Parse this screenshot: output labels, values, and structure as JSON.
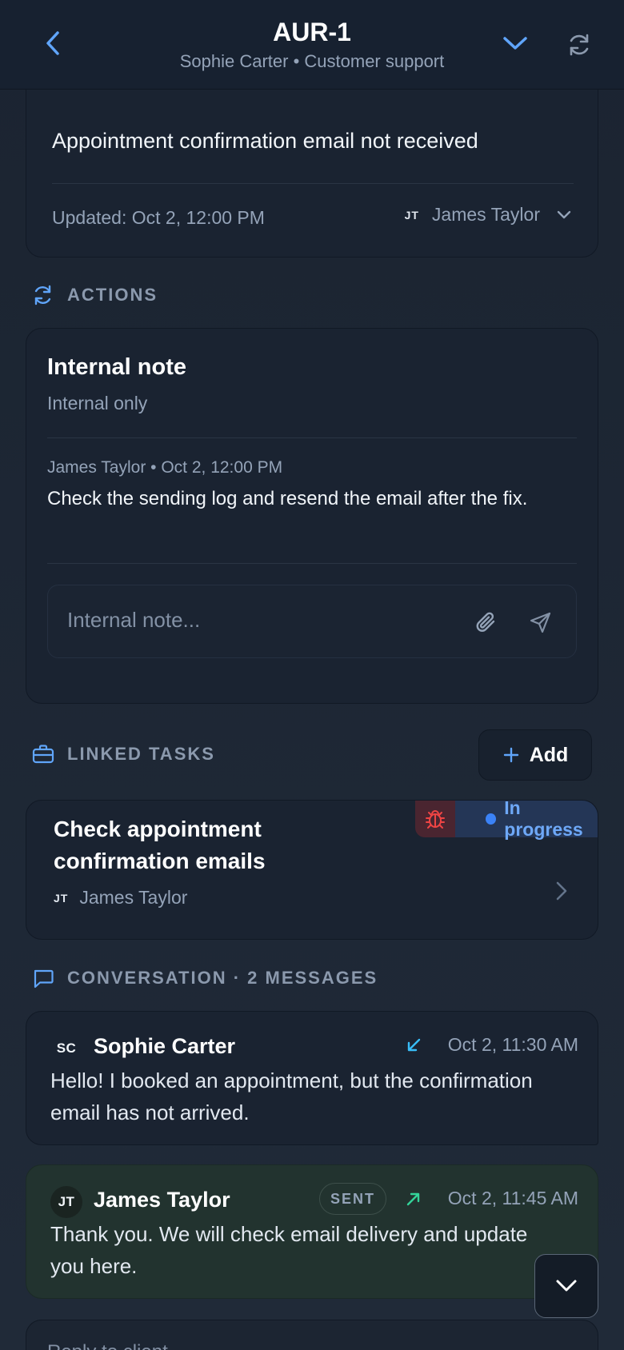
{
  "header": {
    "title": "AUR-1",
    "subtitle": "Sophie Carter • Customer support",
    "back_icon": "chevron-left-icon",
    "collapse_icon": "chevron-down-icon",
    "refresh_icon": "refresh-icon"
  },
  "ticket": {
    "subject": "Appointment confirmation email not received",
    "updated": "Updated: Oct 2, 12:00 PM",
    "assignee_initials": "JT",
    "assignee_name": "James Taylor"
  },
  "actions": {
    "section_label": "ACTIONS",
    "title": "Internal note",
    "subtitle": "Internal only",
    "note": {
      "meta": "James Taylor • Oct 2, 12:00 PM",
      "text": "Check the sending log and resend the email after the fix."
    },
    "input_placeholder": "Internal note..."
  },
  "linked_tasks": {
    "section_label": "LINKED TASKS",
    "add_label": "Add",
    "items": [
      {
        "title": "Check appointment confirmation emails",
        "assignee_initials": "JT",
        "assignee_name": "James Taylor",
        "status": "In progress"
      }
    ]
  },
  "conversation": {
    "section_label": "CONVERSATION · 2 MESSAGES",
    "messages": [
      {
        "initials": "SC",
        "name": "Sophie Carter",
        "time": "Oct 2, 11:30 AM",
        "direction": "incoming",
        "body": "Hello! I booked an appointment, but the confirmation email has not arrived."
      },
      {
        "initials": "JT",
        "name": "James Taylor",
        "badge": "SENT",
        "time": "Oct 2, 11:45 AM",
        "direction": "outgoing",
        "body": "Thank you. We will check email delivery and update you here."
      }
    ],
    "reply_placeholder": "Reply to client..."
  },
  "colors": {
    "accent": "#60a5fa",
    "status_blue": "#3b82f6",
    "bug_red": "#ef4444",
    "incoming_arrow": "#38bdf8",
    "outgoing_arrow": "#34d399"
  }
}
